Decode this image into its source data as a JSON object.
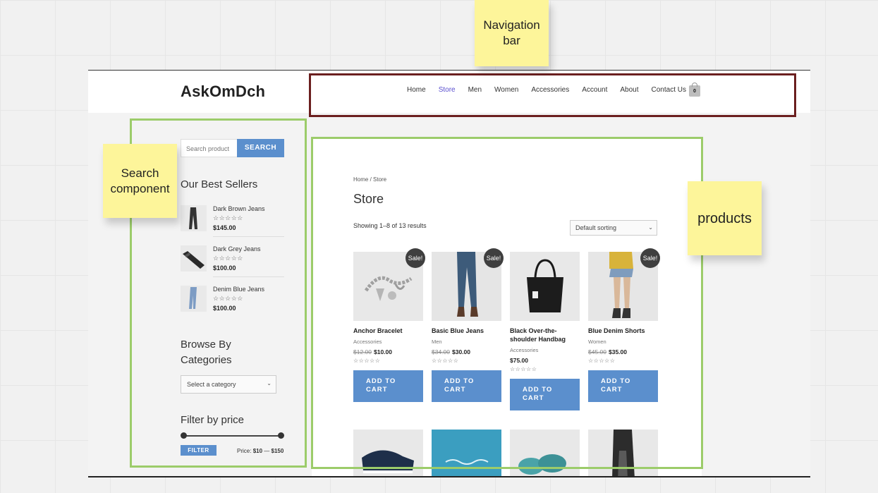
{
  "site": {
    "logo": "AskOmDch",
    "nav": [
      "Home",
      "Store",
      "Men",
      "Women",
      "Accessories",
      "Account",
      "About",
      "Contact Us"
    ],
    "active_nav": "Store",
    "cart_count": "0"
  },
  "sidebar": {
    "search_placeholder": "Search product",
    "search_button": "SEARCH",
    "best_sellers_title": "Our Best Sellers",
    "best_sellers": [
      {
        "name": "Dark Brown Jeans",
        "stars": "☆☆☆☆☆",
        "price": "$145.00"
      },
      {
        "name": "Dark Grey Jeans",
        "stars": "☆☆☆☆☆",
        "price": "$100.00"
      },
      {
        "name": "Denim Blue Jeans",
        "stars": "☆☆☆☆☆",
        "price": "$100.00"
      }
    ],
    "browse_title_1": "Browse By",
    "browse_title_2": "Categories",
    "category_select": "Select a category",
    "filter_title": "Filter by price",
    "filter_button": "FILTER",
    "price_label": "Price:",
    "price_min": "$10",
    "price_sep": "—",
    "price_max": "$150"
  },
  "main": {
    "breadcrumb": "Home / Store",
    "title": "Store",
    "showing": "Showing 1–8 of 13 results",
    "sorting": "Default sorting",
    "sale_label": "Sale!",
    "add_to_cart_1": "ADD TO",
    "add_to_cart_2": "CART",
    "products": [
      {
        "name": "Anchor Bracelet",
        "category": "Accessories",
        "old_price": "$12.00",
        "price": "$10.00",
        "stars": "☆☆☆☆☆"
      },
      {
        "name": "Basic Blue Jeans",
        "category": "Men",
        "old_price": "$34.00",
        "price": "$30.00",
        "stars": "☆☆☆☆☆"
      },
      {
        "name_1": "Black Over-the-",
        "name_2": "shoulder Handbag",
        "category": "Accessories",
        "price": "$75.00",
        "stars": "☆☆☆☆☆"
      },
      {
        "name": "Blue Denim Shorts",
        "category": "Women",
        "old_price": "$45.00",
        "price": "$35.00",
        "stars": "☆☆☆☆☆"
      }
    ]
  },
  "annotations": {
    "nav_note_1": "Navigation",
    "nav_note_2": "bar",
    "search_note_1": "Search",
    "search_note_2": "component",
    "products_note": "products",
    "nav_box_color": "#6b1f1f",
    "region_box_color": "#9ccc6a"
  }
}
